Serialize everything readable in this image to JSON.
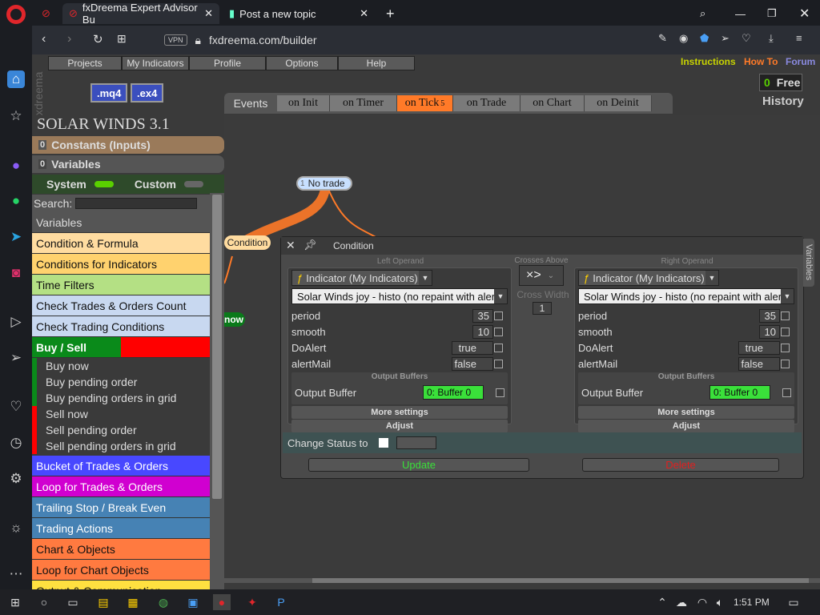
{
  "browser": {
    "tabs": [
      {
        "title": "fxDreema Expert Advisor Bu"
      },
      {
        "title": "Post a new topic"
      }
    ],
    "url": "fxdreema.com/builder",
    "vpn_label": "VPN"
  },
  "menu": {
    "items": [
      "Projects",
      "My Indicators",
      "Profile",
      "Options",
      "Help"
    ],
    "links": [
      {
        "label": "Instructions",
        "color": "#c8d400"
      },
      {
        "label": "How To",
        "color": "#ff7a28"
      },
      {
        "label": "Forum",
        "color": "#8a8ae0"
      }
    ],
    "sidebar_brand": "fxdreema"
  },
  "exports": {
    "mq4": ".mq4",
    "ex4": ".ex4"
  },
  "account": {
    "count": "0",
    "plan": "Free",
    "history": "History"
  },
  "events": {
    "label": "Events",
    "tabs": [
      {
        "label": "on Init",
        "active": false
      },
      {
        "label": "on Timer",
        "active": false
      },
      {
        "label": "on Tick",
        "badge": "5",
        "active": true
      },
      {
        "label": "on Trade",
        "active": false
      },
      {
        "label": "on Chart",
        "active": false
      },
      {
        "label": "on Deinit",
        "active": false
      }
    ]
  },
  "project": {
    "title": "SOLAR WINDS 3.1",
    "constants": {
      "count": "0",
      "label": "Constants (Inputs)"
    },
    "variables": {
      "count": "0",
      "label": "Variables"
    },
    "system": "System",
    "custom": "Custom",
    "search_label": "Search:",
    "search_value": ""
  },
  "categories": [
    {
      "label": "Variables",
      "bg": "#555555",
      "fg": "#dddddd"
    },
    {
      "label": "Condition & Formula",
      "bg": "#ffdca0",
      "fg": "#111111"
    },
    {
      "label": "Conditions for Indicators",
      "bg": "#ffd26e",
      "fg": "#111111"
    },
    {
      "label": "Time Filters",
      "bg": "#b4e084",
      "fg": "#111111"
    },
    {
      "label": "Check Trades & Orders Count",
      "bg": "#c8d8f0",
      "fg": "#111111"
    },
    {
      "label": "Check Trading Conditions",
      "bg": "#c8d8f0",
      "fg": "#111111"
    }
  ],
  "buysell": {
    "label": "Buy / Sell",
    "buy_items": [
      "Buy now",
      "Buy pending order",
      "Buy pending orders in grid"
    ],
    "sell_items": [
      "Sell now",
      "Sell pending order",
      "Sell pending orders in grid"
    ]
  },
  "categories2": [
    {
      "label": "Bucket of Trades & Orders",
      "bg": "#4848ff",
      "fg": "#ffffff"
    },
    {
      "label": "Loop for Trades & Orders",
      "bg": "#d000d0",
      "fg": "#ffffff"
    },
    {
      "label": "Trailing Stop / Break Even",
      "bg": "#4682b4",
      "fg": "#ffffff"
    },
    {
      "label": "Trading Actions",
      "bg": "#4682b4",
      "fg": "#ffffff"
    },
    {
      "label": "Chart & Objects",
      "bg": "#ff7a40",
      "fg": "#111111"
    },
    {
      "label": "Loop for Chart Objects",
      "bg": "#ff7a40",
      "fg": "#111111"
    },
    {
      "label": "Output & Communication",
      "bg": "#ffe040",
      "fg": "#111111"
    }
  ],
  "canvas": {
    "block_id": "1",
    "block_label": "No trade",
    "condition_label": "Condition",
    "now_label": "now"
  },
  "dialog": {
    "title": "Condition",
    "variables_tab": "Variables",
    "left": {
      "heading": "Left Operand",
      "type": "Indicator (My Indicators)",
      "indicator": "Solar Winds joy - histo (no repaint with alert)",
      "params": [
        {
          "name": "period",
          "value": "35"
        },
        {
          "name": "smooth",
          "value": "10"
        },
        {
          "name": "DoAlert",
          "value": "true"
        },
        {
          "name": "alertMail",
          "value": "false"
        }
      ],
      "buffers_heading": "Output Buffers",
      "buffer_label": "Output Buffer",
      "buffer_value": "0: Buffer 0",
      "more": "More settings",
      "adjust": "Adjust"
    },
    "middle": {
      "heading": "Crosses Above",
      "operator": "×>",
      "cross_label": "Cross Width",
      "cross_value": "1"
    },
    "right": {
      "heading": "Right Operand",
      "type": "Indicator (My Indicators)",
      "indicator": "Solar Winds joy - histo (no repaint with alert)",
      "params": [
        {
          "name": "period",
          "value": "35"
        },
        {
          "name": "smooth",
          "value": "10"
        },
        {
          "name": "DoAlert",
          "value": "true"
        },
        {
          "name": "alertMail",
          "value": "false"
        }
      ],
      "buffers_heading": "Output Buffers",
      "buffer_label": "Output Buffer",
      "buffer_value": "0: Buffer 0",
      "more": "More settings",
      "adjust": "Adjust"
    },
    "status_label": "Change Status to",
    "update": "Update",
    "delete": "Delete"
  },
  "taskbar": {
    "time": "1:51 PM"
  }
}
